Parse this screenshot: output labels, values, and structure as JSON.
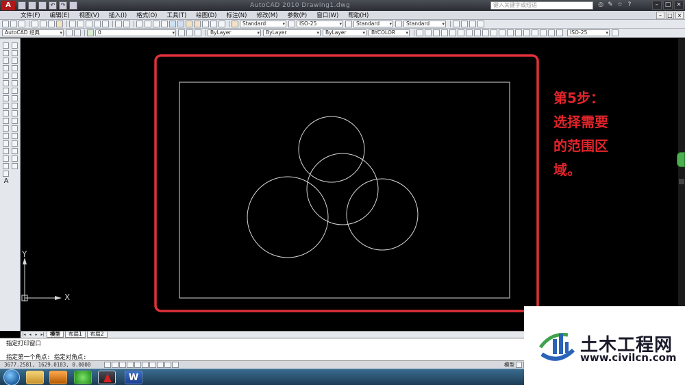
{
  "window": {
    "title": "AutoCAD 2010    Drawing1.dwg",
    "help_search_placeholder": "键入关键字或短语",
    "title_icons": [
      "binoculars-icon",
      "wrench-icon",
      "star-icon",
      "help-icon"
    ]
  },
  "menu": {
    "items": [
      "文件(F)",
      "编辑(E)",
      "视图(V)",
      "插入(I)",
      "格式(O)",
      "工具(T)",
      "绘图(D)",
      "标注(N)",
      "修改(M)",
      "参数(P)",
      "窗口(W)",
      "帮助(H)"
    ]
  },
  "toolbar1": {
    "text_style": "Standard",
    "dim_style": "ISO-25",
    "table_style": "Standard",
    "multileader_style": "Standard"
  },
  "toolbar2": {
    "workspace": "AutoCAD 经典",
    "layer": "0",
    "color": "ByLayer",
    "linetype": "ByLayer",
    "lineweight": "ByLayer",
    "plotstyle": "BYCOLOR",
    "dim_style": "ISO-25"
  },
  "left_toolbar": {
    "text_tool": "A"
  },
  "canvas": {
    "ucs_x": "X",
    "ucs_y": "Y",
    "annotation": [
      "第5步：",
      "选择需要",
      "的范围区",
      "域。"
    ],
    "annotation_color": "#e2242b",
    "selection_color": "#e0303a",
    "line_color": "#d8d8d8"
  },
  "layout_tabs": {
    "tabs": [
      "模型",
      "布局1",
      "布局2"
    ],
    "active": "模型"
  },
  "command_line": {
    "history": "指定打印窗口",
    "prompt": "指定第一个角点: 指定对角点:"
  },
  "status": {
    "coords": "3677.2581, 1629.0183, 0.0000",
    "model": "模型"
  },
  "taskbar": {
    "apps": [
      "start-orb",
      "explorer-icon",
      "media-player-icon",
      "360-browser-icon",
      "autocad-icon",
      "word-icon"
    ],
    "word_label": "W"
  },
  "watermark": {
    "name": "土木工程网",
    "url": "www.civilcn.com"
  }
}
